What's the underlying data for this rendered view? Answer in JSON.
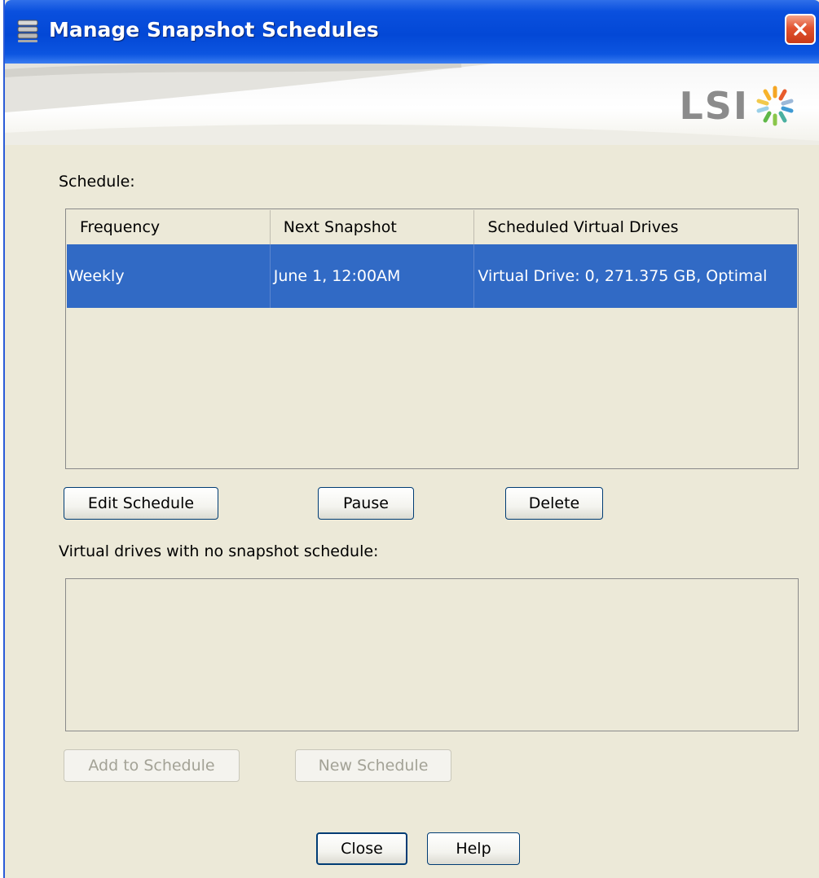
{
  "window": {
    "title": "Manage Snapshot Schedules"
  },
  "logo": {
    "text": "LSI"
  },
  "schedule": {
    "label": "Schedule:",
    "columns": [
      "Frequency",
      "Next Snapshot",
      "Scheduled Virtual Drives"
    ],
    "rows": [
      {
        "frequency": "Weekly",
        "next_snapshot": "June 1, 12:00AM",
        "drives": "Virtual Drive: 0, 271.375 GB, Optimal",
        "selected": true
      }
    ]
  },
  "schedule_buttons": {
    "edit": "Edit Schedule",
    "pause": "Pause",
    "delete": "Delete"
  },
  "unscheduled": {
    "label": "Virtual drives with no snapshot schedule:",
    "items": []
  },
  "unscheduled_buttons": {
    "add": "Add to Schedule",
    "new": "New Schedule"
  },
  "footer_buttons": {
    "close": "Close",
    "help": "Help"
  },
  "colors": {
    "titlebar": "#0348d6",
    "selection": "#316ac5",
    "dialog_bg": "#ece9d8"
  }
}
